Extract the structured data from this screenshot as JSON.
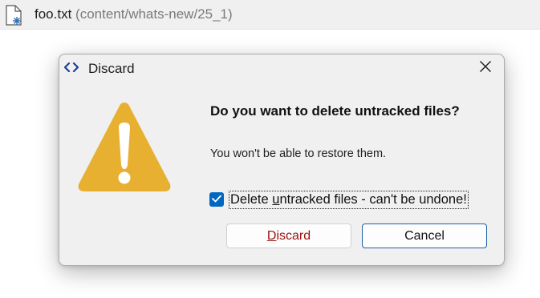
{
  "editor": {
    "file_name": "foo.txt",
    "file_path": "(content/whats-new/25_1)"
  },
  "dialog": {
    "title": "Discard",
    "heading": "Do you want to delete untracked files?",
    "message": "You won't be able to restore them.",
    "checkbox": {
      "label_prefix": "Delete ",
      "label_mnemonic": "u",
      "label_rest": "ntracked files - can't be undone!",
      "checked": true
    },
    "buttons": {
      "discard_mnemonic": "D",
      "discard_rest": "iscard",
      "cancel": "Cancel"
    }
  },
  "icons": {
    "file": "file-icon",
    "app": "code-brackets-icon",
    "close": "close-icon",
    "warning": "warning-icon",
    "check": "checkmark-icon"
  },
  "colors": {
    "warning": "#e8b030",
    "accent": "#0067c0",
    "discard_text": "#a01010"
  }
}
